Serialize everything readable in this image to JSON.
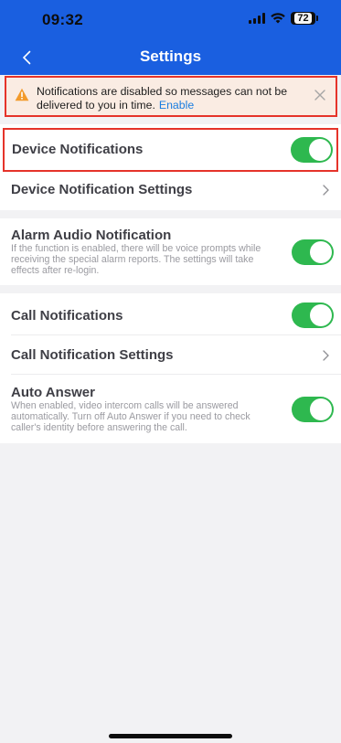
{
  "status_bar": {
    "time": "09:32",
    "battery": "72"
  },
  "nav": {
    "title": "Settings"
  },
  "notice": {
    "message": "Notifications are disabled so messages can not be delivered to you in time.",
    "link": "Enable"
  },
  "settings": {
    "device_notifications": {
      "label": "Device Notifications",
      "enabled": true
    },
    "device_notification_settings": {
      "label": "Device Notification Settings"
    },
    "alarm_audio": {
      "label": "Alarm Audio Notification",
      "description": "If the function is enabled, there will be voice prompts while receiving the special alarm reports. The settings will take effects after re-login.",
      "enabled": true
    },
    "call_notifications": {
      "label": "Call Notifications",
      "enabled": true
    },
    "call_notification_settings": {
      "label": "Call Notification Settings"
    },
    "auto_answer": {
      "label": "Auto Answer",
      "description": "When enabled, video intercom calls will be answered automatically. Turn off Auto Answer if you need to check caller's identity before answering the call.",
      "enabled": true
    }
  },
  "colors": {
    "header": "#1a5fe0",
    "toggle_on": "#2eb84f",
    "highlight_border": "#e5332a",
    "link": "#1a7de0"
  },
  "icons": [
    "back-chevron-icon",
    "warning-icon",
    "close-icon",
    "chevron-right-icon",
    "signal-icon",
    "wifi-icon",
    "battery-icon"
  ]
}
